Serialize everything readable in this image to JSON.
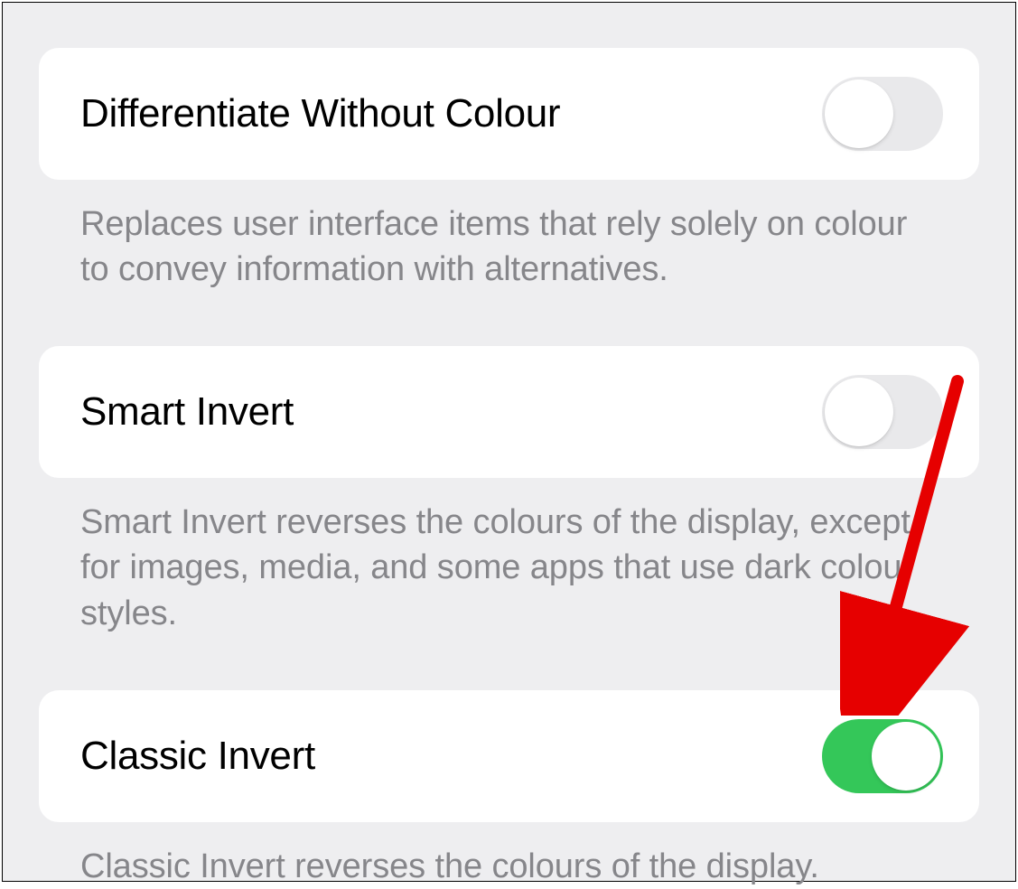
{
  "settings": [
    {
      "id": "differentiate-without-colour",
      "title": "Differentiate Without Colour",
      "desc": "Replaces user interface items that rely solely on colour to convey information with alternatives.",
      "on": false
    },
    {
      "id": "smart-invert",
      "title": "Smart Invert",
      "desc": "Smart Invert reverses the colours of the display, except for images, media, and some apps that use dark colour styles.",
      "on": false
    },
    {
      "id": "classic-invert",
      "title": "Classic Invert",
      "desc": "Classic Invert reverses the colours of the display.",
      "on": true
    }
  ],
  "colors": {
    "toggle_on": "#34c759",
    "toggle_off": "#e9e9eb",
    "annotation_arrow": "#e60000"
  }
}
